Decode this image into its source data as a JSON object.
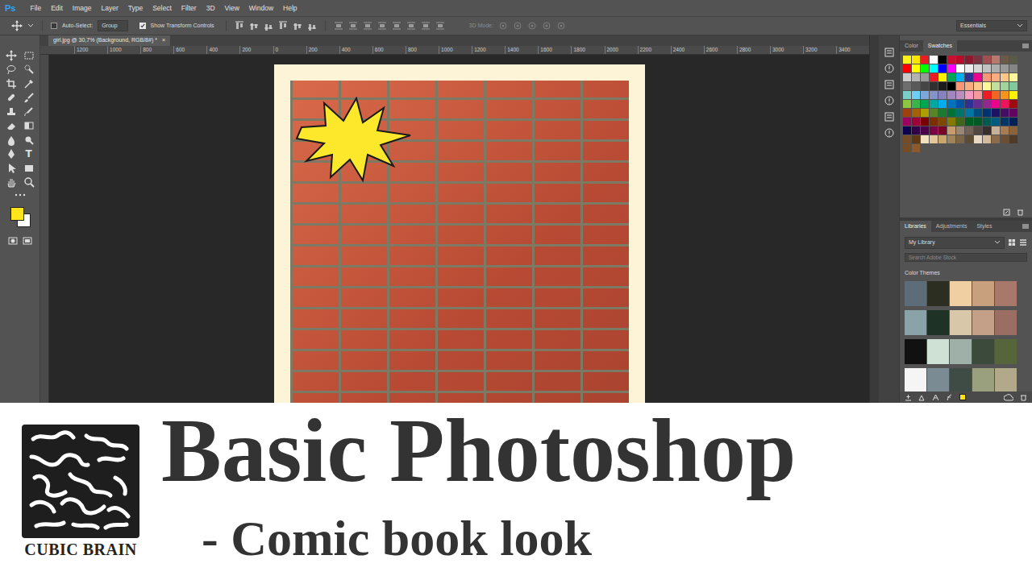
{
  "app": {
    "logo": "Ps",
    "menu": [
      "File",
      "Edit",
      "Image",
      "Layer",
      "Type",
      "Select",
      "Filter",
      "3D",
      "View",
      "Window",
      "Help"
    ]
  },
  "options_bar": {
    "auto_select": {
      "label": "Auto-Select:",
      "checked": false
    },
    "auto_select_target": "Group",
    "transform_controls": {
      "label": "Show Transform Controls",
      "checked": true
    },
    "mode_3d": {
      "label": "3D Mode:",
      "disabled": true
    },
    "workspace": "Essentials"
  },
  "document": {
    "tab": "girl.jpg @ 30,7% (Background, RGB/8#) *",
    "close": "×",
    "ruler": [
      "1200",
      "1000",
      "800",
      "600",
      "400",
      "200",
      "0",
      "200",
      "400",
      "600",
      "800",
      "1000",
      "1200",
      "1400",
      "1600",
      "1800",
      "2000",
      "2200",
      "2400",
      "2600",
      "2800",
      "3000",
      "3200",
      "3400"
    ]
  },
  "tools": {
    "type_tool_glyph": "T",
    "foreground": "#ffe51a",
    "background": "#ffffff"
  },
  "panels": {
    "color_tabs": [
      {
        "label": "Color",
        "selected": false
      },
      {
        "label": "Swatches",
        "selected": true
      }
    ],
    "swatches": [
      "#fff21c",
      "#ffe400",
      "#e31e24",
      "#ffffff",
      "#000000",
      "#c8102e",
      "#b80d2a",
      "#8b1a2e",
      "#7a3340",
      "#a05050",
      "#b87a6e",
      "#6b5a4a",
      "#5a5a48",
      "#ff0000",
      "#ffff00",
      "#00ff00",
      "#00ffff",
      "#0000ff",
      "#ff00ff",
      "#ffffff",
      "#ebebeb",
      "#d6d6d6",
      "#c2c2c2",
      "#adadad",
      "#999999",
      "#858585",
      "#cccccc",
      "#b3b3b3",
      "#999999",
      "#ed1c24",
      "#fff200",
      "#00a651",
      "#00aeef",
      "#2e3192",
      "#ec008c",
      "#f7977a",
      "#f9ad81",
      "#fdc68a",
      "#fff79a",
      "#6e6e6e",
      "#595959",
      "#454545",
      "#303030",
      "#1c1c1c",
      "#000000",
      "#f69679",
      "#f9ad81",
      "#fdc68a",
      "#fff79a",
      "#c4df9b",
      "#a3d39c",
      "#82ca9d",
      "#7bcdc8",
      "#6dcff6",
      "#7da7d9",
      "#8393ca",
      "#8781bd",
      "#a187be",
      "#bc8dbf",
      "#f49ac2",
      "#f6989d",
      "#ed1c24",
      "#f26522",
      "#f7941d",
      "#fff200",
      "#8dc63f",
      "#39b54a",
      "#00a651",
      "#00a99d",
      "#00aeef",
      "#0072bc",
      "#0054a6",
      "#2e3192",
      "#662d91",
      "#92278f",
      "#ec008c",
      "#ed145b",
      "#9e0b0f",
      "#a0410d",
      "#a36209",
      "#aba000",
      "#598527",
      "#1a7b30",
      "#007236",
      "#00746b",
      "#0076a3",
      "#004b80",
      "#003471",
      "#1b1464",
      "#440e62",
      "#630460",
      "#9e005d",
      "#9e0039",
      "#790000",
      "#7b2e00",
      "#7d4900",
      "#827b00",
      "#406618",
      "#005e20",
      "#005826",
      "#005952",
      "#005b7f",
      "#003663",
      "#002157",
      "#0d004c",
      "#32004b",
      "#4b0049",
      "#7b0046",
      "#7a0026",
      "#c69c6d",
      "#998675",
      "#736357",
      "#534741",
      "#362f2d",
      "#c7b299",
      "#a67c52",
      "#8c6239",
      "#754c24",
      "#603913",
      "#f2e1c0",
      "#e3c69b",
      "#c9a66b",
      "#a0845a",
      "#7d6646",
      "#5c4c36",
      "#e8d8c4",
      "#d3bc9e",
      "#8b6d4d",
      "#6b4f34",
      "#4f3a28",
      "#754c24",
      "#8c5a2b"
    ],
    "library_tabs": [
      {
        "label": "Libraries",
        "selected": true
      },
      {
        "label": "Adjustments",
        "selected": false
      },
      {
        "label": "Styles",
        "selected": false
      }
    ],
    "library": "My Library",
    "search": {
      "placeholder": "Search Adobe Stock"
    },
    "color_themes": {
      "title": "Color Themes",
      "themes": [
        [
          "#5c6d79",
          "#2d2e22",
          "#f0cfa3",
          "#c9a07e",
          "#a8786a"
        ],
        [
          "#8aa3a8",
          "#1e3325",
          "#d8c8a9",
          "#c5a088",
          "#9b6e63"
        ],
        [
          "#111111",
          "#cfe0d4",
          "#9fb0a8",
          "#3b4a3a",
          "#56663a"
        ],
        [
          "#f5f5f5",
          "#7a8b94",
          "#3e4c45",
          "#9aa07e",
          "#b2a98a"
        ]
      ]
    }
  },
  "title_card": {
    "brand": "CUBIC BRAIN",
    "title": "Basic Photoshop",
    "subtitle": "- Comic book look"
  }
}
